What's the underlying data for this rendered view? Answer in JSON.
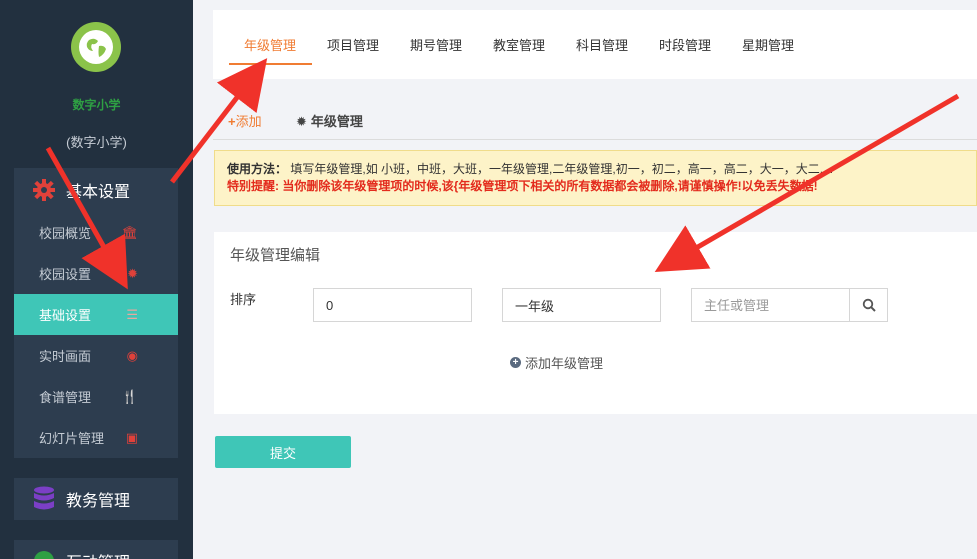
{
  "sidebar": {
    "school_name": "数字小学",
    "school_sub": "(数字小学)",
    "groups": [
      {
        "label": "基本设置",
        "items": [
          {
            "label": "校园概览",
            "icon": "bank-icon"
          },
          {
            "label": "校园设置",
            "icon": "gear-icon"
          },
          {
            "label": "基础设置",
            "icon": "list-icon",
            "active": true
          },
          {
            "label": "实时画面",
            "icon": "eye-icon"
          },
          {
            "label": "食谱管理",
            "icon": "cutlery-icon"
          },
          {
            "label": "幻灯片管理",
            "icon": "picture-icon"
          }
        ]
      }
    ],
    "academic": "教务管理",
    "interaction": "互动管理"
  },
  "tabs": [
    {
      "label": "年级管理",
      "active": true
    },
    {
      "label": "项目管理"
    },
    {
      "label": "期号管理"
    },
    {
      "label": "教室管理"
    },
    {
      "label": "科目管理"
    },
    {
      "label": "时段管理"
    },
    {
      "label": "星期管理"
    }
  ],
  "subtabs": {
    "add": "添加",
    "manage": "年级管理"
  },
  "notice": {
    "usage_title": "使用方法：",
    "usage_text": "填写年级管理,如 小班，中班，大班，一年级管理,二年级管理,初一，初二，高一，高二，大一，大二....",
    "warning": "特别提醒: 当你删除该年级管理项的时候,该{年级管理项下相关的所有数据都会被删除,请谨慎操作!以免丢失数据!"
  },
  "edit": {
    "title": "年级管理编辑",
    "sort_label": "排序",
    "sort_value": "0",
    "grade_value": "一年级",
    "teacher_placeholder": "主任或管理",
    "add_grade": "添加年级管理"
  },
  "submit": "提交",
  "colors": {
    "sidebar_bg": "#22303f",
    "accent_teal": "#3fc6b7",
    "accent_orange": "#f07c33",
    "arrow_red": "#f0322a"
  }
}
